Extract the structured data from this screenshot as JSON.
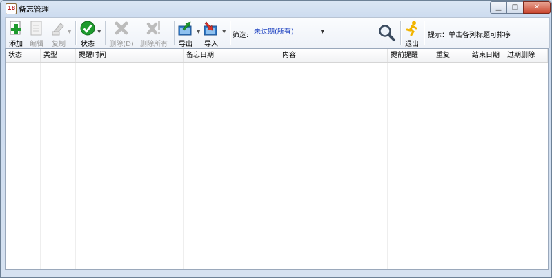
{
  "window": {
    "title": "备忘管理",
    "app_icon_text": "18",
    "controls": {
      "minimize": "▁",
      "maximize": "□",
      "close": "✕"
    }
  },
  "toolbar": {
    "add": "添加",
    "edit": "编辑",
    "copy": "复制",
    "status": "状态",
    "delete": "删除(D)",
    "delete_all": "删除所有",
    "export": "导出",
    "import": "导入",
    "exit": "退出",
    "dropdown_glyph": "▼"
  },
  "filter": {
    "label": "筛选:",
    "selected": "未过期(所有)",
    "arrow": "▼"
  },
  "hint": "提示：单击各列标题可排序",
  "table": {
    "columns": [
      "状态",
      "类型",
      "提醒时间",
      "备忘日期",
      "内容",
      "提前提醒",
      "重复",
      "结束日期",
      "过期删除"
    ],
    "rows": []
  },
  "colors": {
    "accent_green": "#1e9a2e",
    "filter_text": "#1a3fc0",
    "exit_yellow": "#f2b400"
  }
}
